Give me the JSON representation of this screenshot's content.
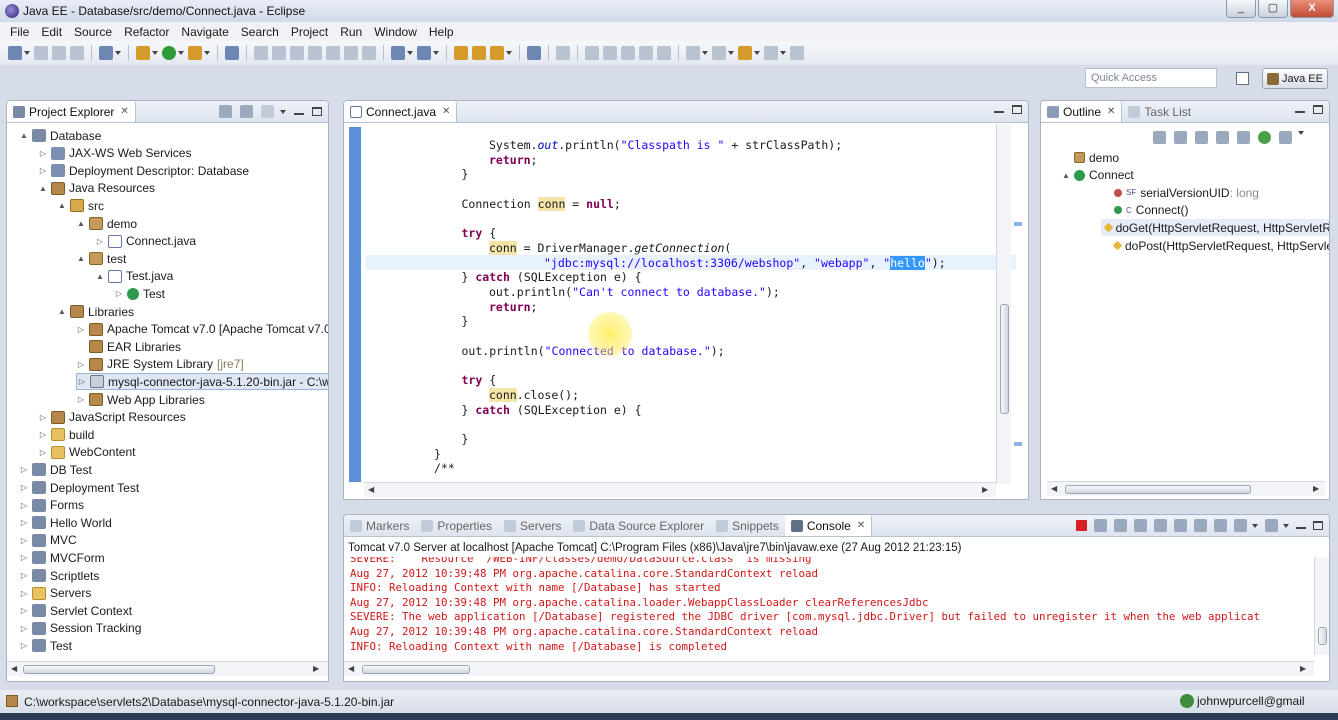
{
  "window": {
    "title": "Java EE - Database/src/demo/Connect.java - Eclipse",
    "controls": [
      "_",
      "▢",
      "X"
    ]
  },
  "menu": [
    "File",
    "Edit",
    "Source",
    "Refactor",
    "Navigate",
    "Search",
    "Project",
    "Run",
    "Window",
    "Help"
  ],
  "toolbar": {
    "quick_access_placeholder": "Quick Access",
    "perspective_label": "Java EE"
  },
  "project_explorer": {
    "tab_label": "Project Explorer",
    "tree": [
      {
        "label": "Database",
        "depth": 0,
        "twisty": "▲",
        "icon": "project-icon"
      },
      {
        "label": "JAX-WS Web Services",
        "depth": 1,
        "twisty": "▷",
        "icon": "web-services-icon"
      },
      {
        "label": "Deployment Descriptor: Database",
        "depth": 1,
        "twisty": "▷",
        "icon": "descriptor-icon"
      },
      {
        "label": "Java Resources",
        "depth": 1,
        "twisty": "▲",
        "icon": "java-resources-icon"
      },
      {
        "label": "src",
        "depth": 2,
        "twisty": "▲",
        "icon": "source-folder-icon"
      },
      {
        "label": "demo",
        "depth": 3,
        "twisty": "▲",
        "icon": "package-icon"
      },
      {
        "label": "Connect.java",
        "depth": 4,
        "twisty": "▷",
        "icon": "java-file-icon"
      },
      {
        "label": "test",
        "depth": 3,
        "twisty": "▲",
        "icon": "package-icon"
      },
      {
        "label": "Test.java",
        "depth": 4,
        "twisty": "▲",
        "icon": "java-file-icon"
      },
      {
        "label": "Test",
        "depth": 5,
        "twisty": "▷",
        "icon": "class-icon"
      },
      {
        "label": "Libraries",
        "depth": 2,
        "twisty": "▲",
        "icon": "library-icon"
      },
      {
        "label": "Apache Tomcat v7.0 [Apache Tomcat v7.0",
        "depth": 3,
        "twisty": "▷",
        "icon": "library-icon"
      },
      {
        "label": "EAR Libraries",
        "depth": 3,
        "twisty": "",
        "icon": "library-icon"
      },
      {
        "label": "JRE System Library",
        "suffix": "[jre7]",
        "depth": 3,
        "twisty": "▷",
        "icon": "library-icon"
      },
      {
        "label": "mysql-connector-java-5.1.20-bin.jar - C:\\w",
        "depth": 3,
        "twisty": "▷",
        "icon": "jar-icon",
        "selected": true
      },
      {
        "label": "Web App Libraries",
        "depth": 3,
        "twisty": "▷",
        "icon": "library-icon"
      },
      {
        "label": "JavaScript Resources",
        "depth": 1,
        "twisty": "▷",
        "icon": "javascript-resources-icon"
      },
      {
        "label": "build",
        "depth": 1,
        "twisty": "▷",
        "icon": "folder-icon"
      },
      {
        "label": "WebContent",
        "depth": 1,
        "twisty": "▷",
        "icon": "folder-icon"
      },
      {
        "label": "DB Test",
        "depth": 0,
        "twisty": "▷",
        "icon": "project-icon"
      },
      {
        "label": "Deployment Test",
        "depth": 0,
        "twisty": "▷",
        "icon": "project-icon"
      },
      {
        "label": "Forms",
        "depth": 0,
        "twisty": "▷",
        "icon": "project-icon"
      },
      {
        "label": "Hello World",
        "depth": 0,
        "twisty": "▷",
        "icon": "project-icon"
      },
      {
        "label": "MVC",
        "depth": 0,
        "twisty": "▷",
        "icon": "project-icon"
      },
      {
        "label": "MVCForm",
        "depth": 0,
        "twisty": "▷",
        "icon": "project-icon"
      },
      {
        "label": "Scriptlets",
        "depth": 0,
        "twisty": "▷",
        "icon": "project-icon"
      },
      {
        "label": "Servers",
        "depth": 0,
        "twisty": "▷",
        "icon": "folder-icon"
      },
      {
        "label": "Servlet Context",
        "depth": 0,
        "twisty": "▷",
        "icon": "project-icon"
      },
      {
        "label": "Session Tracking",
        "depth": 0,
        "twisty": "▷",
        "icon": "project-icon"
      },
      {
        "label": "Test",
        "depth": 0,
        "twisty": "▷",
        "icon": "project-icon"
      }
    ]
  },
  "editor": {
    "tab_label": "Connect.java",
    "lines": [
      {
        "indent": 2,
        "parts": [
          [
            "plain",
            "System."
          ],
          [
            "it",
            "out"
          ],
          [
            "plain",
            ".println("
          ],
          [
            "str",
            "\"Classpath is \""
          ],
          [
            "plain",
            " + strClassPath);"
          ]
        ]
      },
      {
        "indent": 2,
        "parts": [
          [
            "kw",
            "return"
          ],
          [
            "plain",
            ";"
          ]
        ]
      },
      {
        "indent": 1,
        "parts": [
          [
            "plain",
            "}"
          ]
        ]
      },
      {
        "indent": 0,
        "parts": []
      },
      {
        "indent": 1,
        "parts": [
          [
            "plain",
            "Connection "
          ],
          [
            "var",
            "conn"
          ],
          [
            "plain",
            " = "
          ],
          [
            "kw",
            "null"
          ],
          [
            "plain",
            ";"
          ]
        ]
      },
      {
        "indent": 0,
        "parts": []
      },
      {
        "indent": 1,
        "parts": [
          [
            "kw",
            "try"
          ],
          [
            "plain",
            " {"
          ]
        ]
      },
      {
        "indent": 2,
        "parts": [
          [
            "var",
            "conn"
          ],
          [
            "plain",
            " = DriverManager."
          ],
          [
            "itp",
            "getConnection"
          ],
          [
            "plain",
            "("
          ]
        ]
      },
      {
        "indent": 4,
        "parts": [
          [
            "str",
            "\"jdbc:mysql://localhost:3306/webshop\""
          ],
          [
            "plain",
            ", "
          ],
          [
            "str",
            "\"webapp\""
          ],
          [
            "plain",
            ", "
          ],
          [
            "str",
            "\""
          ],
          [
            "sel",
            "hello"
          ],
          [
            "str",
            "\""
          ],
          [
            "plain",
            ");"
          ]
        ]
      },
      {
        "indent": 1,
        "parts": [
          [
            "plain",
            "} "
          ],
          [
            "kw",
            "catch"
          ],
          [
            "plain",
            " (SQLException e) {"
          ]
        ]
      },
      {
        "indent": 2,
        "parts": [
          [
            "plain",
            "out.println("
          ],
          [
            "str",
            "\"Can't connect to database.\""
          ],
          [
            "plain",
            ");"
          ]
        ]
      },
      {
        "indent": 2,
        "parts": [
          [
            "kw",
            "return"
          ],
          [
            "plain",
            ";"
          ]
        ]
      },
      {
        "indent": 1,
        "parts": [
          [
            "plain",
            "}"
          ]
        ]
      },
      {
        "indent": 0,
        "parts": []
      },
      {
        "indent": 1,
        "parts": [
          [
            "plain",
            "out.println("
          ],
          [
            "str",
            "\"Connected to database.\""
          ],
          [
            "plain",
            ");"
          ]
        ]
      },
      {
        "indent": 0,
        "parts": []
      },
      {
        "indent": 1,
        "parts": [
          [
            "kw",
            "try"
          ],
          [
            "plain",
            " {"
          ]
        ]
      },
      {
        "indent": 2,
        "parts": [
          [
            "var",
            "conn"
          ],
          [
            "plain",
            ".close();"
          ]
        ]
      },
      {
        "indent": 1,
        "parts": [
          [
            "plain",
            "} "
          ],
          [
            "kw",
            "catch"
          ],
          [
            "plain",
            " (SQLException e) {"
          ]
        ]
      },
      {
        "indent": 0,
        "parts": []
      },
      {
        "indent": 1,
        "parts": [
          [
            "plain",
            "}"
          ]
        ]
      },
      {
        "indent": 0,
        "parts": [
          [
            "plain",
            "}"
          ]
        ]
      },
      {
        "indent": 0,
        "parts": [
          [
            "plain",
            "/**"
          ]
        ]
      }
    ]
  },
  "outline": {
    "tabs": [
      "Outline",
      "Task List"
    ],
    "items": [
      {
        "label": "demo",
        "depth": 0,
        "icon": "package-icon",
        "twisty": ""
      },
      {
        "label": "Connect",
        "depth": 0,
        "icon": "class-icon",
        "twisty": "▲"
      },
      {
        "label": "serialVersionUID",
        "suffix": ": long",
        "depth": 1,
        "icon": "field-icon",
        "badge": "SF"
      },
      {
        "label": "Connect()",
        "depth": 1,
        "icon": "constructor-icon",
        "badge": "C"
      },
      {
        "label": "doGet(HttpServletRequest, HttpServletR",
        "depth": 1,
        "icon": "method-icon",
        "badge": "",
        "selected": true
      },
      {
        "label": "doPost(HttpServletRequest, HttpServletR",
        "depth": 1,
        "icon": "method-icon",
        "badge": ""
      }
    ]
  },
  "console": {
    "tabs": [
      "Markers",
      "Properties",
      "Servers",
      "Data Source Explorer",
      "Snippets",
      "Console"
    ],
    "active_tab": "Console",
    "header": "Tomcat v7.0 Server at localhost [Apache Tomcat] C:\\Program Files (x86)\\Java\\jre7\\bin\\javaw.exe (27 Aug 2012 21:23:15)",
    "lines": [
      "SEVERE:    Resource  /WEB-INF/classes/demo/DataSource.class  is missing",
      "Aug 27, 2012 10:39:48 PM org.apache.catalina.core.StandardContext reload",
      "INFO: Reloading Context with name [/Database] has started",
      "Aug 27, 2012 10:39:48 PM org.apache.catalina.loader.WebappClassLoader clearReferencesJdbc",
      "SEVERE: The web application [/Database] registered the JDBC driver [com.mysql.jdbc.Driver] but failed to unregister it when the web applicat",
      "Aug 27, 2012 10:39:48 PM org.apache.catalina.core.StandardContext reload",
      "INFO: Reloading Context with name [/Database] is completed"
    ]
  },
  "status": {
    "path": "C:\\workspace\\servlets2\\Database\\mysql-connector-java-5.1.20-bin.jar",
    "user": "johnwpurcell@gmail"
  },
  "colors": {
    "accent": "#5b8fd8",
    "error_text": "#d01818",
    "keyword": "#7f0055",
    "string": "#2a00ff"
  }
}
